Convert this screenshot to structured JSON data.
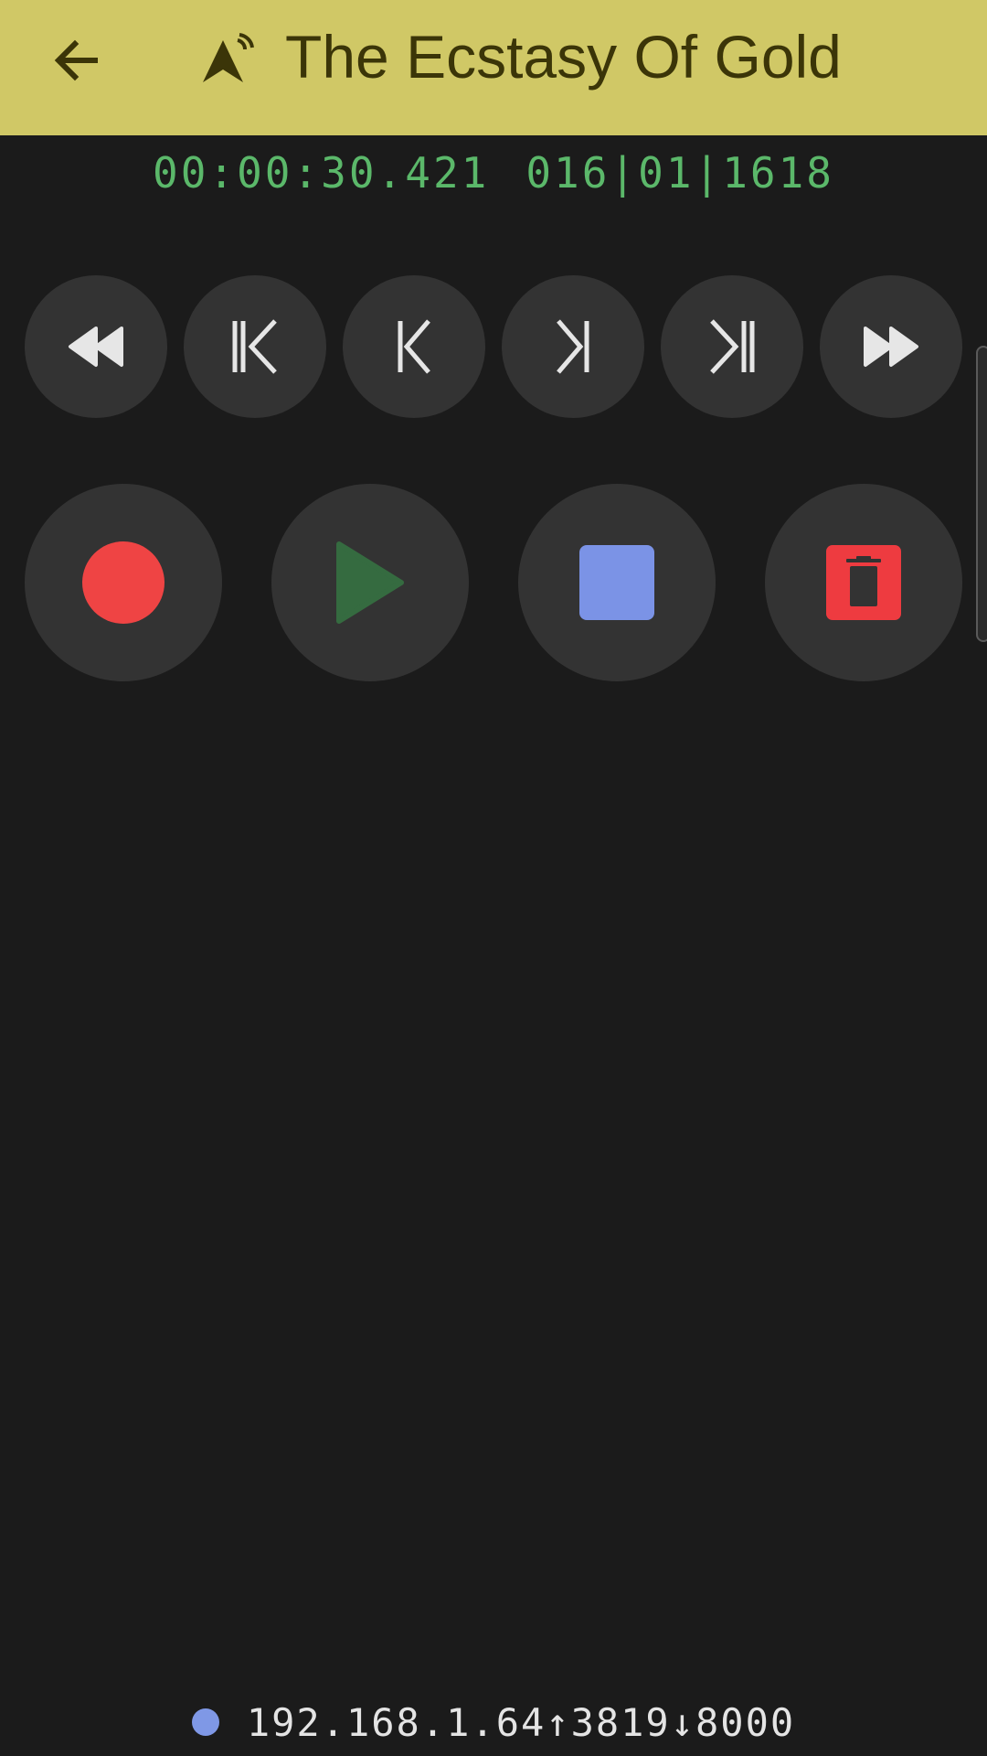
{
  "header": {
    "title": "The Ecstasy Of Gold",
    "back_icon": "arrow-left-icon",
    "app_icon": "broadcast-arrow-icon",
    "background": "#d0c866",
    "text_color": "#3b3508"
  },
  "position": {
    "time": "00:00:30.421",
    "bars_beats": "016|01|1618",
    "color": "#5bb86a"
  },
  "transport": [
    {
      "name": "rewind",
      "icon": "fast-rewind-icon"
    },
    {
      "name": "goto-start",
      "icon": "skip-to-start-icon"
    },
    {
      "name": "previous-marker",
      "icon": "previous-marker-icon"
    },
    {
      "name": "next-marker",
      "icon": "next-marker-icon"
    },
    {
      "name": "goto-end",
      "icon": "skip-to-end-icon"
    },
    {
      "name": "fast-forward",
      "icon": "fast-forward-icon"
    }
  ],
  "actions": [
    {
      "name": "record",
      "icon": "record-icon",
      "color": "#ef4444"
    },
    {
      "name": "play",
      "icon": "play-icon",
      "color": "#356b40"
    },
    {
      "name": "stop",
      "icon": "stop-icon",
      "color": "#7b93e6"
    },
    {
      "name": "delete",
      "icon": "trash-icon",
      "color": "#ee3b40"
    }
  ],
  "status": {
    "indicator_color": "#7f98e6",
    "connection": "192.168.1.64↑3819↓8000"
  }
}
